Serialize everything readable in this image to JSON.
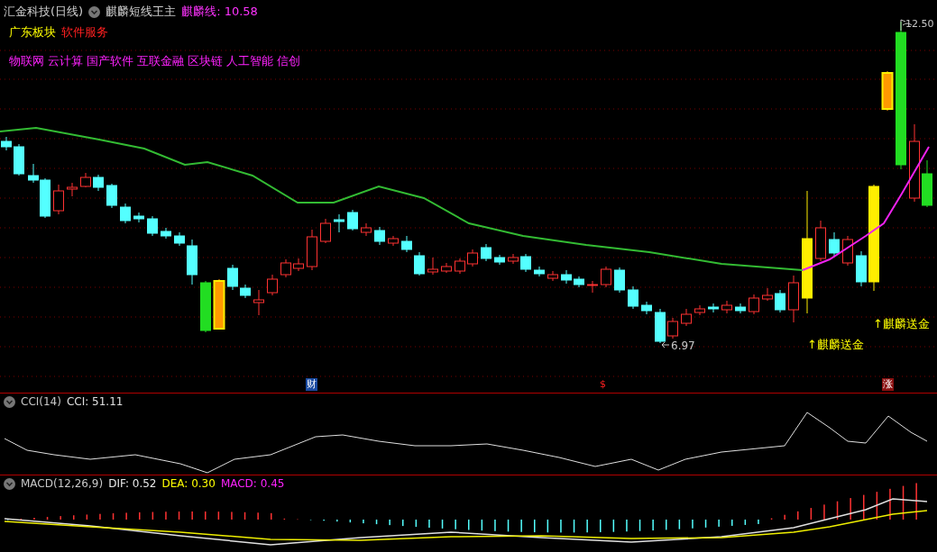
{
  "header": {
    "symbol": "汇金科技(日线)",
    "indicator": "麒麟短线王主",
    "line_label": "麒麟线: 10.58"
  },
  "sector": {
    "region": "广东板块",
    "industry": "软件服务"
  },
  "concepts": [
    "物联网",
    "云计算",
    "国产软件",
    "互联金融",
    "区块链",
    "人工智能",
    "信创"
  ],
  "annotations": [
    {
      "text": "↑麒麟送金"
    },
    {
      "text": "↑麒麟送金"
    }
  ],
  "price_labels": {
    "low": "6.97",
    "high": "12.50"
  },
  "markers": [
    {
      "kind": "finance",
      "text": "财"
    },
    {
      "kind": "dollar",
      "text": "$"
    },
    {
      "kind": "rise",
      "text": "涨"
    }
  ],
  "cci": {
    "name": "CCI(14)",
    "value": "CCI: 51.11"
  },
  "macd": {
    "name": "MACD(12,26,9)",
    "dif": "DIF: 0.52",
    "dea": "DEA: 0.30",
    "macd": "MACD: 0.45"
  }
}
